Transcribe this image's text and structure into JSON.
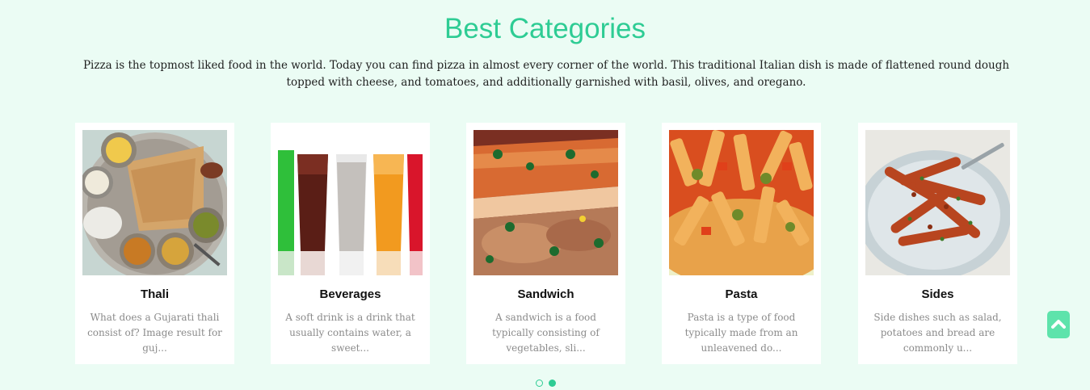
{
  "section": {
    "title": "Best Categories",
    "intro": "Pizza is the topmost liked food in the world. Today you can find pizza in almost every corner of the world. This traditional Italian dish is made of flattened round dough topped with cheese, and tomatoes, and additionally garnished with basil, olives, and oregano."
  },
  "categories": [
    {
      "title": "Thali",
      "description": "What does a Gujarati thali consist of? Image result for guj...",
      "image": "thali-photo"
    },
    {
      "title": "Beverages",
      "description": "A soft drink is a drink that usually contains water, a sweet...",
      "image": "beverages-photo"
    },
    {
      "title": "Sandwich",
      "description": "A sandwich is a food typically consisting of vegetables, sli...",
      "image": "sandwich-photo"
    },
    {
      "title": "Pasta",
      "description": "Pasta is a type of food typically made from an unleavened do...",
      "image": "pasta-photo"
    },
    {
      "title": "Sides",
      "description": "Side dishes such as salad, potatoes and bread are commonly u...",
      "image": "sides-photo"
    }
  ],
  "carousel": {
    "active_index": 2,
    "page_count": 2
  },
  "scroll_top": {
    "icon": "chevron-up-icon"
  },
  "colors": {
    "accent": "#2ecc94",
    "background": "#ebfcf4",
    "scroll_button": "#5ee3ab"
  }
}
